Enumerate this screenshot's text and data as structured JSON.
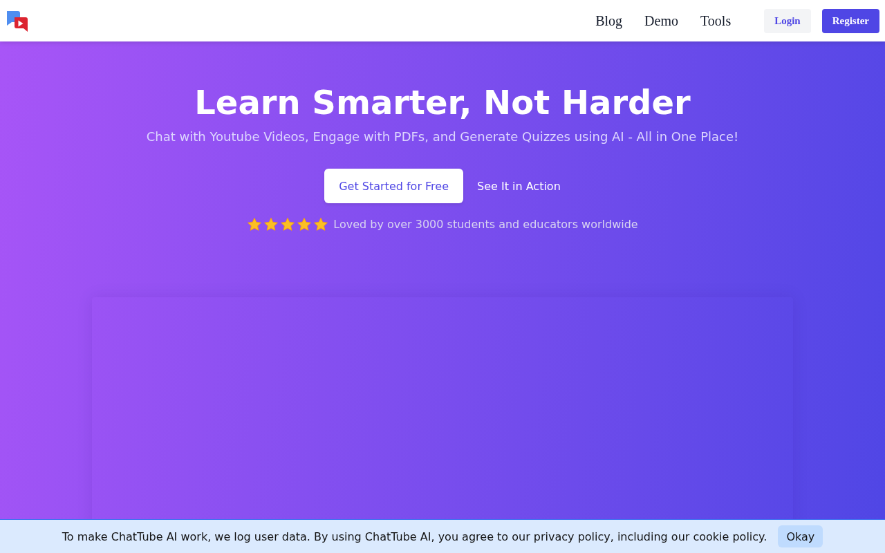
{
  "nav": {
    "links": [
      {
        "label": "Blog"
      },
      {
        "label": "Demo"
      },
      {
        "label": "Tools"
      }
    ],
    "login": "Login",
    "register": "Register"
  },
  "hero": {
    "title": "Learn Smarter, Not Harder",
    "subtitle": "Chat with Youtube Videos, Engage with PDFs, and Generate Quizzes using AI - All in One Place!",
    "primary_button": "Get Started for Free",
    "secondary_link": "See It in Action",
    "rating": {
      "stars": 5,
      "text": "Loved by over 3000 students and educators worldwide"
    }
  },
  "cookie_banner": {
    "text": "To make ChatTube AI work, we log user data. By using ChatTube AI, you agree to our privacy policy, including our cookie policy.",
    "button": "Okay"
  }
}
